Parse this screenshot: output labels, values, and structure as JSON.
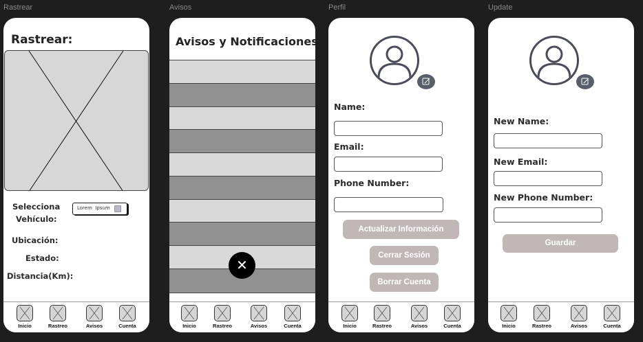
{
  "frames": {
    "rastrear": "Rastrear",
    "avisos": "Avisos",
    "perfil": "Perfil",
    "update": "Update"
  },
  "nav": [
    "Inicio",
    "Rastreo",
    "Avisos",
    "Cuenta"
  ],
  "rastrear": {
    "title": "Rastrear:",
    "select_label_line1": "Selecciona",
    "select_label_line2": "Vehículo:",
    "select_value": "Lorem  Ipsum",
    "ubicacion": "Ubicación:",
    "estado": "Estado:",
    "distancia": "Distancia(Km):"
  },
  "avisos": {
    "title": "Avisos y Notificaciones:",
    "close_glyph": "✕"
  },
  "perfil": {
    "name_label": "Name:",
    "email_label": "Email:",
    "phone_label": "Phone Number:",
    "update_button": "Actualizar Información",
    "logout_button": "Cerrar Sesión",
    "delete_button": "Borrar Cuenta"
  },
  "update": {
    "name_label": "New Name:",
    "email_label": "New Email:",
    "phone_label": "New Phone Number:",
    "save_button": "Guardar"
  },
  "colors": {
    "background": "#1e1e1e",
    "button": "#c2b7b7",
    "row_light": "#d9d9d9",
    "row_dark": "#929192",
    "avatar_stroke": "#4a4d59"
  }
}
